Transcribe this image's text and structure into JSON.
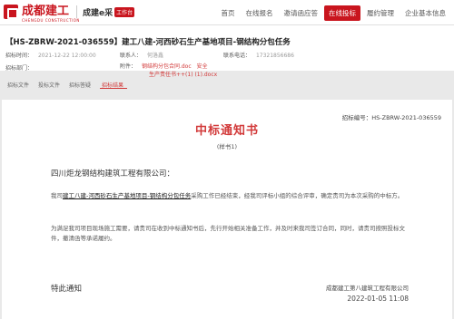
{
  "brand": {
    "logo_text": "成都建工",
    "logo_sub": "CHENGDU CONSTRUCTION",
    "secondary": "成建e采",
    "secondary_badge": "工作台"
  },
  "nav": [
    {
      "label": "首页",
      "active": false
    },
    {
      "label": "在线报名",
      "active": false
    },
    {
      "label": "邀请函应答",
      "active": false
    },
    {
      "label": "在线投标",
      "active": true
    },
    {
      "label": "履约管理",
      "active": false
    },
    {
      "label": "企业基本信息",
      "active": false
    }
  ],
  "project": {
    "title": "【HS-ZBRW-2021-036559】建工八建-河西砂石生产基地项目-钢结构分包任务",
    "fields": {
      "publish_time_label": "招标时间：",
      "publish_time_value": "2021-12-22 12:00:00",
      "contact_label": "联系人：",
      "contact_value": "何洛鑫",
      "phone_label": "联系电话：",
      "phone_value": "17321856686",
      "dept_label": "招标部门：",
      "attachment_label": "附件：",
      "attachment_1": "钢结构分包合同.doc",
      "attachment_1b": "安全",
      "attachment_2": "生产责任书++(1) (1).docx"
    }
  },
  "tabs": [
    {
      "label": "招标文件",
      "active": false
    },
    {
      "label": "投标文件",
      "active": false
    },
    {
      "label": "招标答疑",
      "active": false
    },
    {
      "label": "招标结果",
      "active": true
    }
  ],
  "notice": {
    "number_label": "招标编号：HS-ZBRW-2021-036559",
    "title": "中标通知书",
    "sample": "(样书1)",
    "recipient": "四川炬龙钢结构建筑工程有限公司：",
    "para1_prefix": "我司",
    "para1_link": "建工八建-河西砂石生产基地项目-钢结构分包任务",
    "para1_suffix": "采购工作已经结束，经我司评标小组的综合评审，确定贵司为本次采购的中标方。",
    "para2": "为满足我司项目现场施工需要，请贵司在收到中标通知书后，先行开始相关准备工作，并及时来我司签订合同，同时，请贵司按照投标文件，撤清函等承诺履约。",
    "closing": "特此通知",
    "issuer": "成都建工第八建筑工程有限公司",
    "date": "2022-01-05 11:08"
  }
}
